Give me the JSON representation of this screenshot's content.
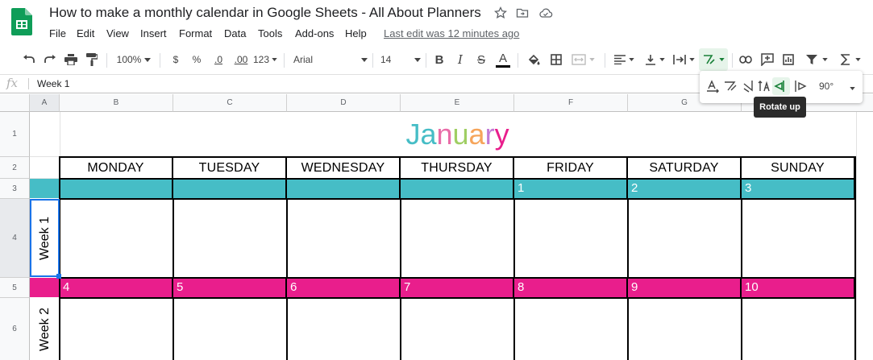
{
  "app": {
    "title": "How to make a monthly calendar in Google Sheets - All About Planners",
    "last_edit": "Last edit was 12 minutes ago",
    "logo_color": "#0f9d58"
  },
  "menu": [
    "File",
    "Edit",
    "View",
    "Insert",
    "Format",
    "Data",
    "Tools",
    "Add-ons",
    "Help"
  ],
  "toolbar": {
    "zoom": "100%",
    "currency": "$",
    "percent": "%",
    "decimal_decrease": ".0",
    "decimal_increase": ".00",
    "more_formats": "123",
    "font": "Arial",
    "font_size": "14",
    "bold": "B",
    "italic": "I",
    "strike": "S",
    "text_color": "A"
  },
  "formula_bar": {
    "fx": "fx",
    "value": "Week 1"
  },
  "columns": [
    "A",
    "B",
    "C",
    "D",
    "E",
    "F",
    "G"
  ],
  "rows": [
    "1",
    "2",
    "3",
    "4",
    "5",
    "6"
  ],
  "calendar": {
    "month": [
      "J",
      "a",
      "n",
      "u",
      "a",
      "r",
      "y"
    ],
    "month_colors": [
      "#46bdc6",
      "#46bdc6",
      "#e96ca8",
      "#9fce63",
      "#f6a55b",
      "#c27ad6",
      "#e91e8c"
    ],
    "days": [
      "MONDAY",
      "TUESDAY",
      "WEDNESDAY",
      "THURSDAY",
      "FRIDAY",
      "SATURDAY",
      "SUNDAY"
    ],
    "week1_dates": [
      "",
      "",
      "",
      "",
      "1",
      "2",
      "3"
    ],
    "week2_dates": [
      "4",
      "5",
      "6",
      "7",
      "8",
      "9",
      "10"
    ],
    "week1_color": "#46bdc6",
    "week2_color": "#e91e8c",
    "week_labels": [
      "Week 1",
      "Week 2"
    ]
  },
  "rotate_popup": {
    "angle": "90°",
    "tooltip": "Rotate up"
  }
}
